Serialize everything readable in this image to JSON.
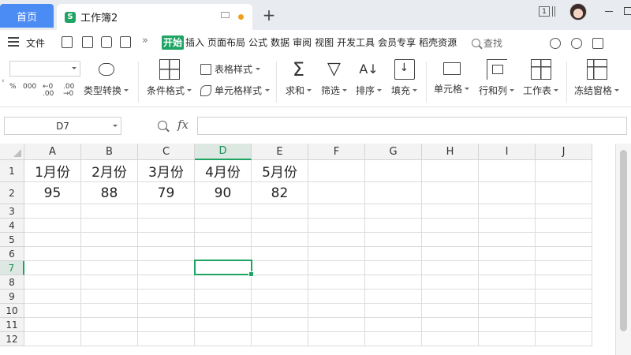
{
  "titlebar": {
    "home_tab": "首页",
    "doc_tab": {
      "logo": "S",
      "title": "工作簿2"
    },
    "new_tab": "+",
    "page_indicator": "1"
  },
  "menubar": {
    "file_label": "文件",
    "more": "»",
    "tabs": [
      {
        "label": "开始",
        "active": true
      },
      {
        "label": "插入"
      },
      {
        "label": "页面布局"
      },
      {
        "label": "公式"
      },
      {
        "label": "数据"
      },
      {
        "label": "审阅"
      },
      {
        "label": "视图"
      },
      {
        "label": "开发工具"
      },
      {
        "label": "会员专享"
      },
      {
        "label": "稻壳资源"
      }
    ],
    "search_label": "查找"
  },
  "ribbon": {
    "format_buttons": [
      "%",
      "000",
      "←0 .00",
      ".00 →0"
    ],
    "type_convert": "类型转换",
    "conditional_format": "条件格式",
    "table_style": "表格样式",
    "cell_style": "单元格样式",
    "sum": "求和",
    "filter": "筛选",
    "sort": "排序",
    "fill": "填充",
    "cells": "单元格",
    "rows_cols": "行和列",
    "worksheet": "工作表",
    "freeze": "冻结窗格"
  },
  "formula_bar": {
    "name_box": "D7",
    "fx": "fx",
    "formula": ""
  },
  "sheet": {
    "columns": [
      "A",
      "B",
      "C",
      "D",
      "E",
      "F",
      "G",
      "H",
      "I",
      "J"
    ],
    "rows": [
      "1",
      "2",
      "3",
      "4",
      "5",
      "6",
      "7",
      "8",
      "9",
      "10",
      "11",
      "12"
    ],
    "selected_col": "D",
    "selected_row": "7",
    "cells": {
      "A1": "1月份",
      "B1": "2月份",
      "C1": "3月份",
      "D1": "4月份",
      "E1": "5月份",
      "A2": "95",
      "B2": "88",
      "C2": "79",
      "D2": "90",
      "E2": "82"
    }
  },
  "colors": {
    "accent": "#1fa463",
    "home_tab": "#4b8bf4",
    "tab_bar": "#e8ebef"
  }
}
